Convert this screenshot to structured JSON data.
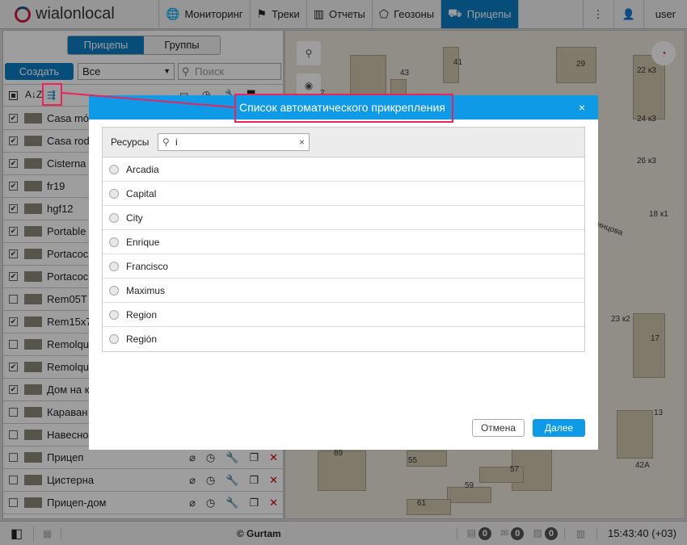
{
  "header": {
    "logo": "wialonlocal",
    "nav": [
      {
        "label": "Мониторинг",
        "icon": "globe-icon"
      },
      {
        "label": "Треки",
        "icon": "flag-icon"
      },
      {
        "label": "Отчеты",
        "icon": "report-icon"
      },
      {
        "label": "Геозоны",
        "icon": "geofence-icon"
      },
      {
        "label": "Прицепы",
        "icon": "trailer-icon",
        "active": true
      }
    ],
    "menu": "⋮",
    "user": "user"
  },
  "left": {
    "tabs": [
      "Прицепы",
      "Группы"
    ],
    "create": "Создать",
    "filter": "Все",
    "search_placeholder": "Поиск",
    "rows": [
      {
        "name": "Casa móvil",
        "checked": true
      },
      {
        "name": "Casa rodante",
        "checked": true
      },
      {
        "name": "Cisterna",
        "checked": true
      },
      {
        "name": "fr19",
        "checked": true
      },
      {
        "name": "hgf12",
        "checked": true
      },
      {
        "name": "Portable house",
        "checked": true
      },
      {
        "name": "Portacoches",
        "checked": true
      },
      {
        "name": "Portacoches",
        "checked": true
      },
      {
        "name": "Rem05T",
        "checked": false
      },
      {
        "name": "Rem15x7",
        "checked": true
      },
      {
        "name": "Remolque",
        "checked": false
      },
      {
        "name": "Remolque",
        "checked": true
      },
      {
        "name": "Дом на колесах",
        "checked": true
      },
      {
        "name": "Караван",
        "checked": false
      },
      {
        "name": "Навесное",
        "checked": false
      },
      {
        "name": "Прицеп",
        "checked": false
      },
      {
        "name": "Цистерна",
        "checked": false
      },
      {
        "name": "Прицеп-дом",
        "checked": false
      }
    ]
  },
  "map": {
    "labels": [
      "41",
      "43",
      "29",
      "22 к3",
      "24 к3",
      "26 к3",
      "18 к1",
      "23 к2",
      "17",
      "13",
      "89",
      "55",
      "57",
      "59",
      "61",
      "42А",
      "2"
    ],
    "street": "инцова"
  },
  "dialog": {
    "title": "Список автоматического прикрепления",
    "close": "×",
    "resources_label": "Ресурсы",
    "filter_value": "i",
    "clear": "×",
    "items": [
      "Arcadia",
      "Capital",
      "City",
      "Enrique",
      "Francisco",
      "Maximus",
      "Region",
      "Región"
    ],
    "cancel": "Отмена",
    "next": "Далее"
  },
  "footer": {
    "copyright": "© Gurtam",
    "counters": [
      "0",
      "0",
      "0"
    ],
    "time": "15:43:40 (+03)"
  },
  "colors": {
    "accent": "#0b7dc4",
    "dialog_header": "#0e9ae6",
    "highlight": "#e8245a"
  }
}
